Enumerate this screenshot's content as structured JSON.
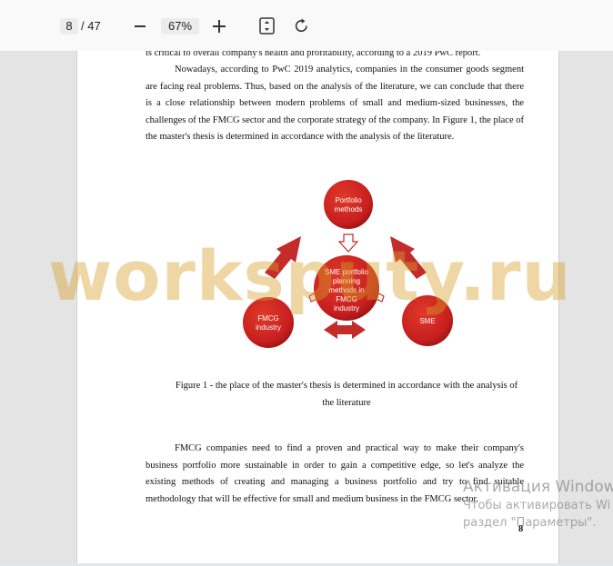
{
  "toolbar": {
    "page_current": "8",
    "page_total": "/ 47",
    "zoom": "67%",
    "icons": {
      "zoom_out": "minus-icon",
      "zoom_in": "plus-icon",
      "fit": "fit-page-icon",
      "rotate": "rotate-icon"
    }
  },
  "document": {
    "top_line": "is critical to overall company's health and profitability, according to a 2019 PwC report.",
    "paragraph1": "Nowadays, according to PwC 2019 analytics, companies in the consumer goods segment are facing real problems. Thus, based on the analysis of the literature, we can conclude that there is a close relationship between modern problems of small and medium-sized businesses, the challenges of the FMCG sector and the corporate strategy of the company. In Figure 1, the place of the master's thesis is determined in accordance with the analysis of the literature.",
    "diagram": {
      "top": [
        "Portfolio",
        "methods"
      ],
      "center": [
        "SME portfolio",
        "planning",
        "methods in",
        "FMCG",
        "industry"
      ],
      "left": [
        "FMCG",
        "industry"
      ],
      "right": [
        "SME"
      ],
      "colors": {
        "circle": "#c81f1f",
        "circle_dark": "#8f0f0f",
        "arrow": "#c42b2b"
      }
    },
    "caption_line1": "Figure 1 - the place of the master's thesis is determined in accordance with the analysis of",
    "caption_line2": "the literature",
    "paragraph2": "FMCG companies need to find a proven and practical way to make their company's business portfolio more sustainable in order to gain a competitive edge, so let's analyze the existing methods of creating and managing a business portfolio and try to find suitable methodology that will be effective for small and medium business in the FMCG sector.",
    "page_number": "8"
  },
  "watermark": "worksputy.ru",
  "activation": {
    "title": "Активация Window",
    "line1": "Чтобы активировать Wi",
    "line2": "раздел \"Параметры\"."
  }
}
